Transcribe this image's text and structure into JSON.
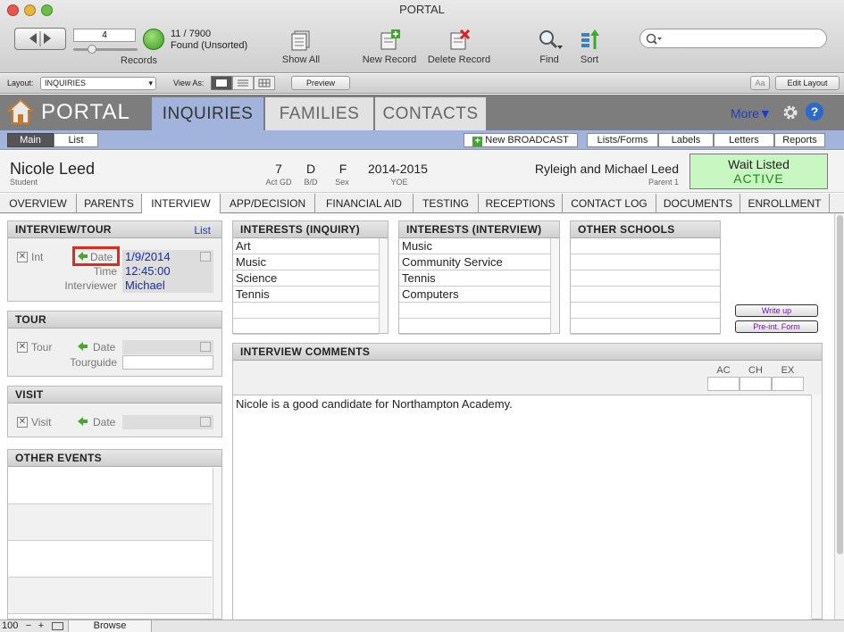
{
  "window": {
    "title": "PORTAL"
  },
  "toolbar": {
    "record_number": "4",
    "records_label": "Records",
    "found_count": "11 / 7900",
    "found_status": "Found (Unsorted)",
    "show_all": "Show All",
    "new_record": "New Record",
    "delete_record": "Delete Record",
    "find": "Find",
    "sort": "Sort",
    "search_placeholder": ""
  },
  "layoutbar": {
    "layout_label": "Layout:",
    "layout_value": "INQUIRIES",
    "view_as_label": "View As:",
    "preview": "Preview",
    "aa": "Aa",
    "edit_layout": "Edit Layout"
  },
  "header": {
    "app_name": "PORTAL",
    "tabs": [
      "INQUIRIES",
      "FAMILIES",
      "CONTACTS"
    ],
    "more": "More"
  },
  "subbar": {
    "main": "Main",
    "list": "List",
    "new_broadcast": "New BROADCAST",
    "lists_forms": "Lists/Forms",
    "labels": "Labels",
    "letters": "Letters",
    "reports": "Reports"
  },
  "student": {
    "name": "Nicole Leed",
    "role": "Student",
    "grade": "7",
    "grade_label": "Act GD",
    "bd": "D",
    "bd_label": "B/D",
    "sex": "F",
    "sex_label": "Sex",
    "yoe": "2014-2015",
    "yoe_label": "YOE",
    "parents": "Ryleigh and Michael Leed",
    "parent_label": "Parent 1",
    "status_top": "Wait Listed",
    "status_bottom": "ACTIVE"
  },
  "section_tabs": [
    "OVERVIEW",
    "PARENTS",
    "INTERVIEW",
    "APP/DECISION",
    "FINANCIAL AID",
    "TESTING",
    "RECEPTIONS",
    "CONTACT LOG",
    "DOCUMENTS",
    "ENROLLMENT"
  ],
  "interview_tour": {
    "title": "INTERVIEW/TOUR",
    "list_link": "List",
    "int_label": "Int",
    "date_label": "Date",
    "date_value": "1/9/2014",
    "time_label": "Time",
    "time_value": "12:45:00",
    "interviewer_label": "Interviewer",
    "interviewer_value": "Michael"
  },
  "tour": {
    "title": "TOUR",
    "tour_label": "Tour",
    "date_label": "Date",
    "tourguide_label": "Tourguide"
  },
  "visit": {
    "title": "VISIT",
    "visit_label": "Visit",
    "date_label": "Date"
  },
  "other_events": {
    "title": "OTHER EVENTS"
  },
  "interests_inquiry": {
    "title": "INTERESTS (INQUIRY)",
    "items": [
      "Art",
      "Music",
      "Science",
      "Tennis",
      "",
      ""
    ]
  },
  "interests_interview": {
    "title": "INTERESTS (INTERVIEW)",
    "items": [
      "Music",
      "Community Service",
      "Tennis",
      "Computers",
      "",
      ""
    ]
  },
  "other_schools": {
    "title": "OTHER SCHOOLS",
    "items": [
      "",
      "",
      "",
      "",
      "",
      ""
    ]
  },
  "buttons": {
    "write_up": "Write up",
    "pre_int_form": "Pre-int. Form"
  },
  "comments": {
    "title": "INTERVIEW COMMENTS",
    "ac": "AC",
    "ch": "CH",
    "ex": "EX",
    "text": "Nicole is a good candidate for Northampton Academy."
  },
  "status": {
    "zoom": "100",
    "mode": "Browse"
  }
}
